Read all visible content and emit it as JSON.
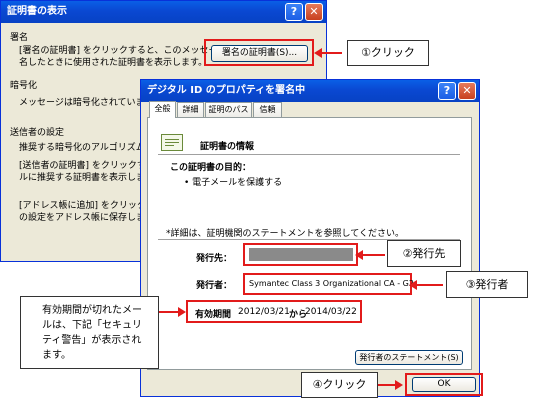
{
  "back_window": {
    "title": "証明書の表示",
    "signature_heading": "署名",
    "signature_text_1": "[署名の証明書] をクリックすると、このメッセージに署",
    "signature_text_2": "名したときに使用された証明書を表示します。",
    "signature_cert_button": "署名の証明書(S)...",
    "encryption_heading": "暗号化",
    "encryption_text": "メッセージは暗号化されていません。",
    "sender_heading": "送信者の設定",
    "sender_algo_text": "推奨する暗号化のアルゴリズム：",
    "sender_text_1": "[送信者の証明書] をクリックすると、",
    "sender_text_2": "ルに推奨する証明書を表示します。",
    "sender_text_3": "[アドレス帳に追加] をクリックすると、",
    "sender_text_4": "の設定をアドレス帳に保存します。"
  },
  "front_window": {
    "title": "デジタル ID のプロパティを署名中",
    "tabs": [
      "全般",
      "詳細",
      "証明のパス",
      "信頼"
    ],
    "cert_info_title": "証明書の情報",
    "purpose_label": "この証明書の目的：",
    "purpose_item": "• 電子メールを保護する",
    "detail_note": "*詳細は、証明機関のステートメントを参照してください。",
    "issued_to_label": "発行先：",
    "issued_by_label": "発行者：",
    "issued_by_value": "Symantec Class 3 Organizational CA - G2",
    "validity_label": "有効期間",
    "validity_from": "2012/03/21",
    "validity_word": "から",
    "validity_to": "2014/03/22",
    "issuer_statement_button": "発行者のステートメント(S)",
    "ok_button": "OK"
  },
  "title_buttons": {
    "help": "?",
    "close": "✕"
  },
  "callouts": {
    "click1": "①クリック",
    "issued_to": "②発行先",
    "issuer": "③発行者",
    "click4": "④クリック",
    "note_line1": "有効期間が切れたメー",
    "note_line2": "ルは、下記「セキュリ",
    "note_line3": "ティ警告」が表示され",
    "note_line4": "ます。"
  },
  "colors": {
    "accent_red": "#e21b1b",
    "title_blue": "#0a48d2"
  }
}
